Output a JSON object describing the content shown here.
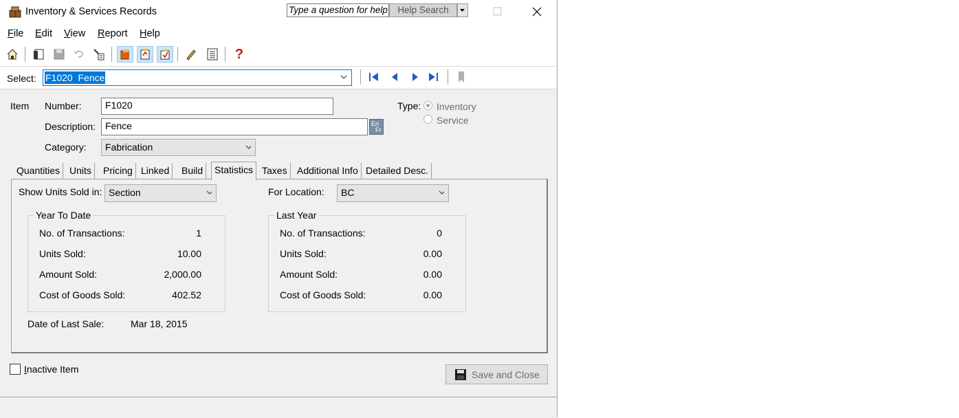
{
  "window": {
    "title": "Inventory & Services Records",
    "help_placeholder": "Type a question for help",
    "help_search_label": "Help Search"
  },
  "menu": {
    "items": [
      {
        "label": "File",
        "key": "F",
        "rest": "ile"
      },
      {
        "label": "Edit",
        "key": "E",
        "rest": "dit"
      },
      {
        "label": "View",
        "key": "V",
        "rest": "iew"
      },
      {
        "label": "Report",
        "key": "R",
        "rest": "eport"
      },
      {
        "label": "Help",
        "key": "H",
        "rest": "elp"
      }
    ]
  },
  "toolbar": {
    "icons": [
      "home-icon",
      "open-icon",
      "save-icon",
      "undo-icon",
      "remove-icon",
      "inventory-icon",
      "notes-icon",
      "calendar-icon",
      "edit-icon",
      "calculator-icon",
      "help-icon"
    ]
  },
  "select": {
    "label": "Select:",
    "value": "F1020  Fence"
  },
  "item": {
    "section_label": "Item",
    "number_label": "Number:",
    "number_value": "F1020",
    "description_label": "Description:",
    "description_value": "Fence",
    "lang_badge_top": "En",
    "lang_badge_bottom": "Fr",
    "category_label": "Category:",
    "category_value": "Fabrication",
    "type_label": "Type:",
    "type_inventory": "Inventory",
    "type_service": "Service"
  },
  "tabs": [
    "Quantities",
    "Units",
    "Pricing",
    "Linked",
    "Build",
    "Statistics",
    "Taxes",
    "Additional Info",
    "Detailed Desc."
  ],
  "active_tab": "Statistics",
  "stats": {
    "show_units_label": "Show Units Sold in:",
    "show_units_value": "Section",
    "location_label": "For Location:",
    "location_value": "BC",
    "ytd": {
      "title": "Year To Date",
      "transactions_label": "No. of Transactions:",
      "transactions": "1",
      "units_label": "Units Sold:",
      "units": "10.00",
      "amount_label": "Amount Sold:",
      "amount": "2,000.00",
      "cogs_label": "Cost of Goods Sold:",
      "cogs": "402.52"
    },
    "last_year": {
      "title": "Last Year",
      "transactions_label": "No. of Transactions:",
      "transactions": "0",
      "units_label": "Units Sold:",
      "units": "0.00",
      "amount_label": "Amount Sold:",
      "amount": "0.00",
      "cogs_label": "Cost of Goods Sold:",
      "cogs": "0.00"
    },
    "last_sale_label": "Date of Last Sale:",
    "last_sale_value": "Mar 18, 2015"
  },
  "footer": {
    "inactive_label": "Inactive Item",
    "save_close_label": "Save and Close"
  }
}
